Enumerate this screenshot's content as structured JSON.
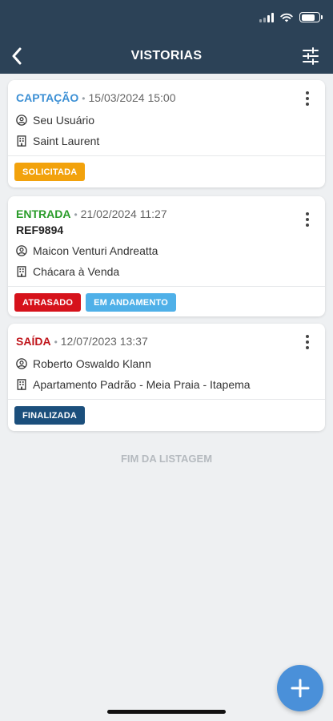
{
  "header": {
    "title": "VISTORIAS",
    "bg_color": "#2c4257",
    "back_icon": "chevron-left-icon",
    "filter_icon": "sliders-icon"
  },
  "status": {
    "battery_level": 0.8,
    "wifi": "connected"
  },
  "cards": [
    {
      "type": "CAPTAÇÃO",
      "type_color": "#3b8fd4",
      "date": "15/03/2024 15:00",
      "ref": "",
      "user": "Seu Usuário",
      "property": "Saint Laurent",
      "badges": [
        {
          "label": "SOLICITADA",
          "color": "#f2a20c"
        }
      ]
    },
    {
      "type": "ENTRADA",
      "type_color": "#2a9c2a",
      "date": "21/02/2024 11:27",
      "ref": "REF9894",
      "user": "Maicon Venturi Andreatta",
      "property": "Chácara à Venda",
      "badges": [
        {
          "label": "ATRASADO",
          "color": "#d6121b"
        },
        {
          "label": "EM ANDAMENTO",
          "color": "#4fb0e8"
        }
      ]
    },
    {
      "type": "SAÍDA",
      "type_color": "#c0161c",
      "date": "12/07/2023 13:37",
      "ref": "",
      "user": "Roberto Oswaldo Klann",
      "property": "Apartamento Padrão - Meia Praia - Itapema",
      "badges": [
        {
          "label": "FINALIZADA",
          "color": "#1b4f7c"
        }
      ]
    }
  ],
  "separator": "•",
  "end_label": "FIM DA LISTAGEM",
  "fab": {
    "icon": "plus-icon",
    "color": "#4a90d9"
  }
}
